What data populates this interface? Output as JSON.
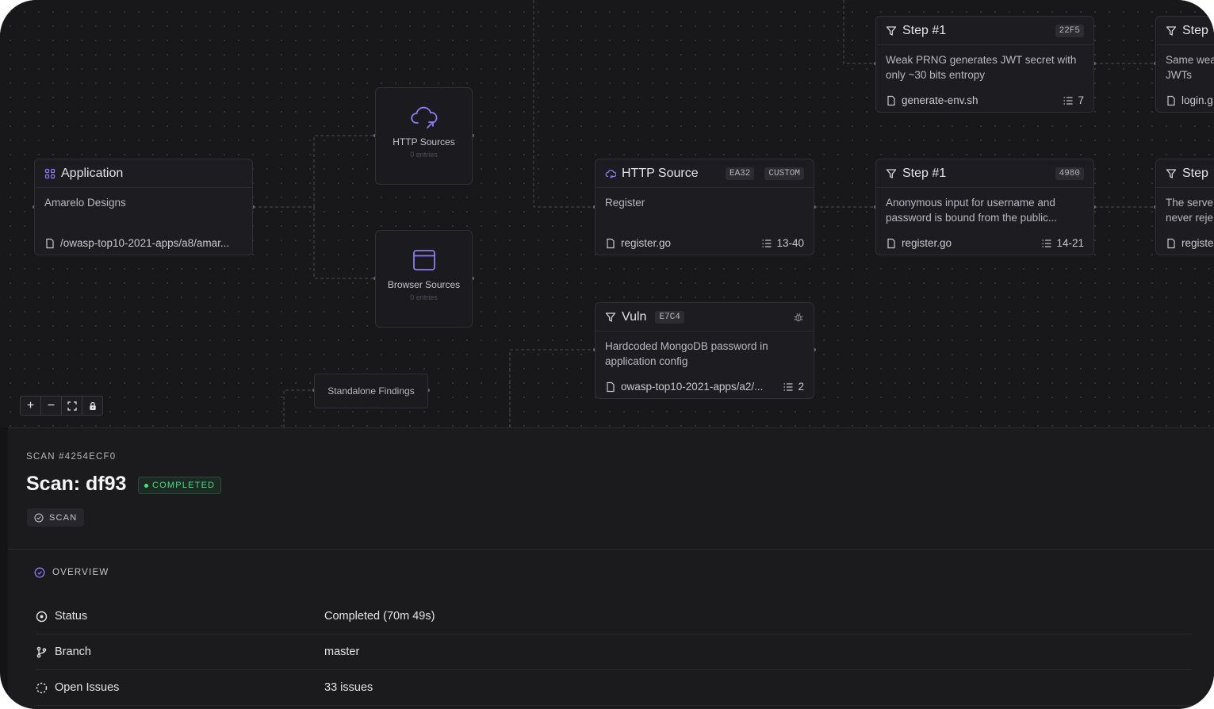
{
  "canvas": {
    "application": {
      "title": "Application",
      "body": "Amarelo Designs",
      "file": "/owasp-top10-2021-apps/a8/amar..."
    },
    "http_sources": {
      "label": "HTTP Sources",
      "count": "0 entries"
    },
    "browser_sources": {
      "label": "Browser Sources",
      "count": "0 entries"
    },
    "standalone": {
      "label": "Standalone Findings"
    },
    "http_source": {
      "title": "HTTP Source",
      "badge1": "EA32",
      "badge2": "CUSTOM",
      "body": "Register",
      "file": "register.go",
      "lines": "13-40"
    },
    "step_top": {
      "title": "Step #1",
      "badge": "22F5",
      "body1": "Weak PRNG generates JWT secret with",
      "body2": "only ~30 bits entropy",
      "file": "generate-env.sh",
      "lines": "7"
    },
    "step_top_right": {
      "title": "Step",
      "body1": "Same wea",
      "body2": "JWTs",
      "file": "login.g"
    },
    "step_mid": {
      "title": "Step #1",
      "badge": "4980",
      "body1": "Anonymous input for username and",
      "body2": "password is bound from the public...",
      "file": "register.go",
      "lines": "14-21"
    },
    "step_mid_right": {
      "title": "Step",
      "body1": "The serve",
      "body2": "never reje",
      "file": "registe"
    },
    "vuln": {
      "title": "Vuln",
      "badge": "E7C4",
      "body1": "Hardcoded MongoDB password in",
      "body2": "application config",
      "file": "owasp-top10-2021-apps/a2/...",
      "lines": "2"
    },
    "controls": {
      "zoom_in": "+",
      "zoom_out": "−"
    }
  },
  "panel": {
    "scan_id": "SCAN #4254ECF0",
    "title": "Scan: df93",
    "status": "COMPLETED",
    "chip": "SCAN",
    "overview": "OVERVIEW",
    "rows": [
      {
        "key": "Status",
        "value": "Completed (70m 49s)"
      },
      {
        "key": "Branch",
        "value": "master"
      },
      {
        "key": "Open Issues",
        "value": "33 issues"
      }
    ]
  },
  "colors": {
    "background": "#18181b",
    "accent": "#8b7cf6",
    "success": "#4ade80"
  }
}
